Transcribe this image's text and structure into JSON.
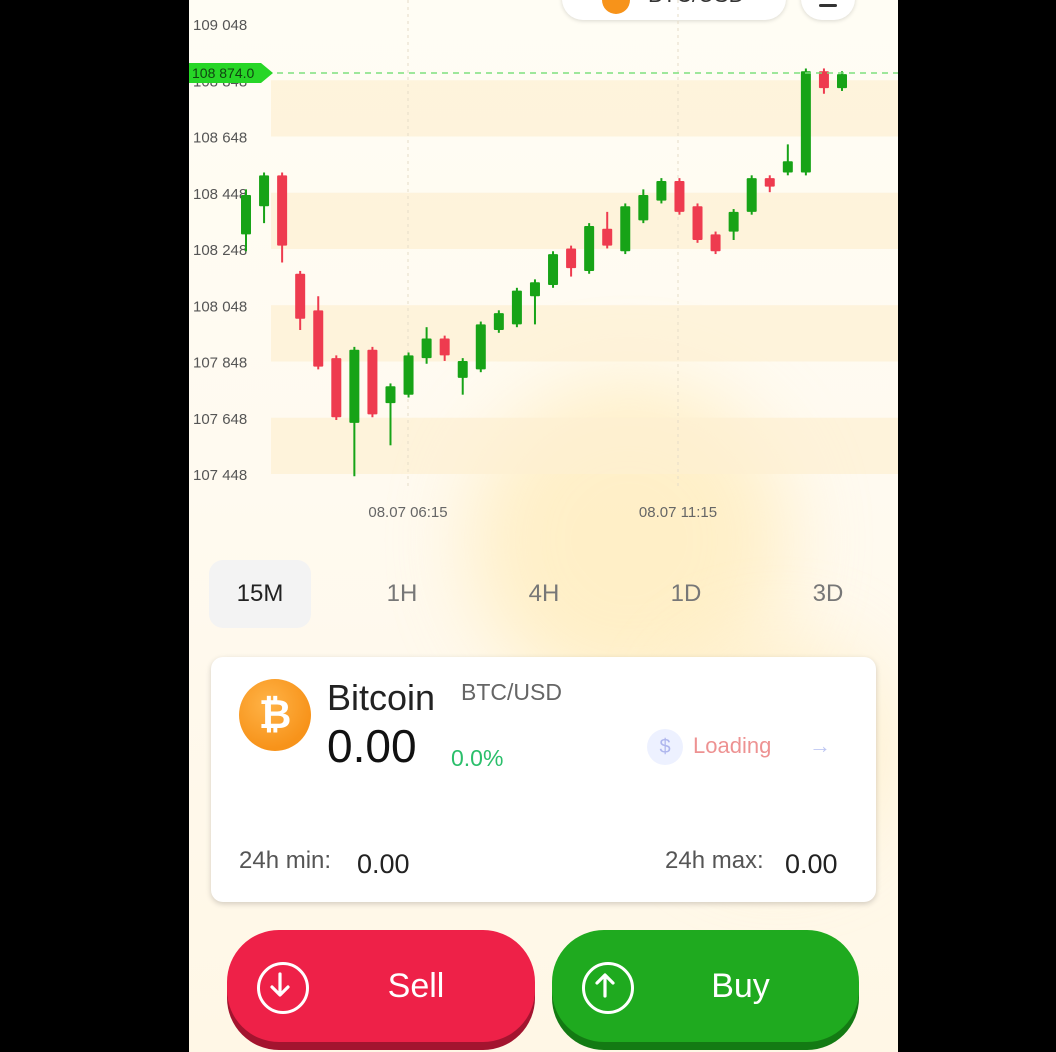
{
  "header": {
    "pair_label": "BTC/USD",
    "pair_icon": "bitcoin-icon",
    "menu_icon": "menu-icon"
  },
  "chart": {
    "current_price": "108 874.0",
    "y_labels": [
      "109 048",
      "108 848",
      "108 648",
      "108 448",
      "108 248",
      "108 048",
      "107 848",
      "107 648",
      "107 448"
    ],
    "x_labels": [
      "08.07 06:15",
      "08.07 11:15"
    ],
    "colors": {
      "up": "#17a317",
      "down": "#ee3b4f",
      "current": "#27d627"
    }
  },
  "chart_data": {
    "type": "candlestick",
    "title": "",
    "xlabel": "",
    "ylabel": "",
    "ylim": [
      107448,
      109048
    ],
    "x_tick_labels": [
      "08.07 06:15",
      "08.07 11:15"
    ],
    "current_price": 108874.0,
    "candles": [
      {
        "o": 108300,
        "c": 108440,
        "h": 108460,
        "l": 108240,
        "dir": "up"
      },
      {
        "o": 108400,
        "c": 108510,
        "h": 108520,
        "l": 108340,
        "dir": "up"
      },
      {
        "o": 108510,
        "c": 108260,
        "h": 108520,
        "l": 108200,
        "dir": "down"
      },
      {
        "o": 108160,
        "c": 108000,
        "h": 108170,
        "l": 107960,
        "dir": "down"
      },
      {
        "o": 108030,
        "c": 107830,
        "h": 108080,
        "l": 107820,
        "dir": "down"
      },
      {
        "o": 107860,
        "c": 107650,
        "h": 107870,
        "l": 107640,
        "dir": "down"
      },
      {
        "o": 107630,
        "c": 107890,
        "h": 107900,
        "l": 107440,
        "dir": "up"
      },
      {
        "o": 107890,
        "c": 107660,
        "h": 107900,
        "l": 107650,
        "dir": "down"
      },
      {
        "o": 107700,
        "c": 107760,
        "h": 107770,
        "l": 107550,
        "dir": "up"
      },
      {
        "o": 107730,
        "c": 107870,
        "h": 107880,
        "l": 107720,
        "dir": "up"
      },
      {
        "o": 107860,
        "c": 107930,
        "h": 107970,
        "l": 107840,
        "dir": "up"
      },
      {
        "o": 107930,
        "c": 107870,
        "h": 107940,
        "l": 107850,
        "dir": "down"
      },
      {
        "o": 107790,
        "c": 107850,
        "h": 107860,
        "l": 107730,
        "dir": "up"
      },
      {
        "o": 107820,
        "c": 107980,
        "h": 107990,
        "l": 107810,
        "dir": "up"
      },
      {
        "o": 107960,
        "c": 108020,
        "h": 108030,
        "l": 107950,
        "dir": "up"
      },
      {
        "o": 107980,
        "c": 108100,
        "h": 108110,
        "l": 107970,
        "dir": "up"
      },
      {
        "o": 108080,
        "c": 108130,
        "h": 108140,
        "l": 107980,
        "dir": "up"
      },
      {
        "o": 108120,
        "c": 108230,
        "h": 108240,
        "l": 108110,
        "dir": "up"
      },
      {
        "o": 108250,
        "c": 108180,
        "h": 108260,
        "l": 108150,
        "dir": "down"
      },
      {
        "o": 108170,
        "c": 108330,
        "h": 108340,
        "l": 108160,
        "dir": "up"
      },
      {
        "o": 108320,
        "c": 108260,
        "h": 108380,
        "l": 108250,
        "dir": "down"
      },
      {
        "o": 108240,
        "c": 108400,
        "h": 108410,
        "l": 108230,
        "dir": "up"
      },
      {
        "o": 108350,
        "c": 108440,
        "h": 108460,
        "l": 108340,
        "dir": "up"
      },
      {
        "o": 108420,
        "c": 108490,
        "h": 108500,
        "l": 108410,
        "dir": "up"
      },
      {
        "o": 108490,
        "c": 108380,
        "h": 108500,
        "l": 108370,
        "dir": "down"
      },
      {
        "o": 108400,
        "c": 108280,
        "h": 108410,
        "l": 108270,
        "dir": "down"
      },
      {
        "o": 108300,
        "c": 108240,
        "h": 108310,
        "l": 108230,
        "dir": "down"
      },
      {
        "o": 108310,
        "c": 108380,
        "h": 108390,
        "l": 108280,
        "dir": "up"
      },
      {
        "o": 108380,
        "c": 108500,
        "h": 108510,
        "l": 108370,
        "dir": "up"
      },
      {
        "o": 108470,
        "c": 108500,
        "h": 108510,
        "l": 108450,
        "dir": "down"
      },
      {
        "o": 108520,
        "c": 108560,
        "h": 108620,
        "l": 108510,
        "dir": "up"
      },
      {
        "o": 108520,
        "c": 108880,
        "h": 108890,
        "l": 108510,
        "dir": "up"
      },
      {
        "o": 108880,
        "c": 108820,
        "h": 108890,
        "l": 108800,
        "dir": "down"
      },
      {
        "o": 108820,
        "c": 108870,
        "h": 108880,
        "l": 108810,
        "dir": "up"
      }
    ]
  },
  "timeframes": {
    "items": [
      "15M",
      "1H",
      "4H",
      "1D",
      "3D"
    ],
    "active": "15M"
  },
  "asset": {
    "logo_icon": "bitcoin-icon",
    "name": "Bitcoin",
    "pair": "BTC/USD",
    "price": "0.00",
    "change": "0.0%",
    "min_label": "24h min:",
    "min_value": "0.00",
    "max_label": "24h max:",
    "max_value": "0.00",
    "promo_text": "Loading"
  },
  "actions": {
    "sell_label": "Sell",
    "sell_icon": "arrow-down-circle-icon",
    "buy_label": "Buy",
    "buy_icon": "arrow-up-circle-icon",
    "sell_color": "#ee2148",
    "buy_color": "#1faa1f"
  }
}
